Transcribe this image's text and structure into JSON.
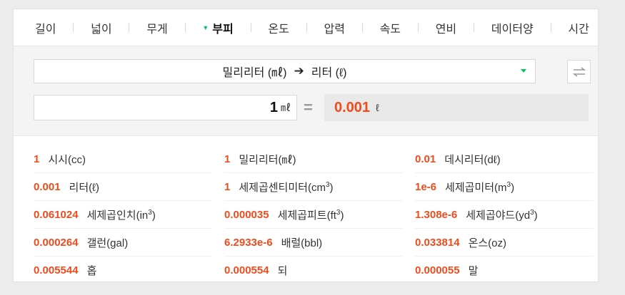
{
  "tabs": [
    {
      "label": "길이",
      "active": false
    },
    {
      "label": "넓이",
      "active": false
    },
    {
      "label": "무게",
      "active": false
    },
    {
      "label": "부피",
      "active": true
    },
    {
      "label": "온도",
      "active": false
    },
    {
      "label": "압력",
      "active": false
    },
    {
      "label": "속도",
      "active": false
    },
    {
      "label": "연비",
      "active": false
    },
    {
      "label": "데이터양",
      "active": false
    },
    {
      "label": "시간",
      "active": false
    }
  ],
  "converter": {
    "from_unit": "밀리리터 (㎖)",
    "arrow": "➔",
    "to_unit": "리터 (ℓ)",
    "input_value": "1",
    "input_unit": "㎖",
    "equals": "=",
    "result_value": "0.001",
    "result_unit": "ℓ"
  },
  "results": [
    [
      {
        "value": "1",
        "name": "시시(cc)"
      },
      {
        "value": "1",
        "name": "밀리리터(㎖)"
      },
      {
        "value": "0.01",
        "name": "데시리터(dℓ)"
      }
    ],
    [
      {
        "value": "0.001",
        "name": "리터(ℓ)"
      },
      {
        "value": "1",
        "name": "세제곱센티미터(cm",
        "sup": "3",
        "tail": ")"
      },
      {
        "value": "1e-6",
        "name": "세제곱미터(m",
        "sup": "3",
        "tail": ")"
      }
    ],
    [
      {
        "value": "0.061024",
        "name": "세제곱인치(in",
        "sup": "3",
        "tail": ")"
      },
      {
        "value": "0.000035",
        "name": "세제곱피트(ft",
        "sup": "3",
        "tail": ")"
      },
      {
        "value": "1.308e-6",
        "name": "세제곱야드(yd",
        "sup": "3",
        "tail": ")"
      }
    ],
    [
      {
        "value": "0.000264",
        "name": "갤런(gal)"
      },
      {
        "value": "6.2933e-6",
        "name": "배럴(bbl)"
      },
      {
        "value": "0.033814",
        "name": "온스(oz)"
      }
    ],
    [
      {
        "value": "0.005544",
        "name": "홉"
      },
      {
        "value": "0.000554",
        "name": "되"
      },
      {
        "value": "0.000055",
        "name": "말"
      }
    ]
  ],
  "colors": {
    "accent": "#f04b1c",
    "brand_green": "#03c75a"
  },
  "icons": {
    "swap": "swap-arrows-icon",
    "dropdown": "dropdown-triangle-icon",
    "active_tab": "active-tab-triangle-icon"
  }
}
